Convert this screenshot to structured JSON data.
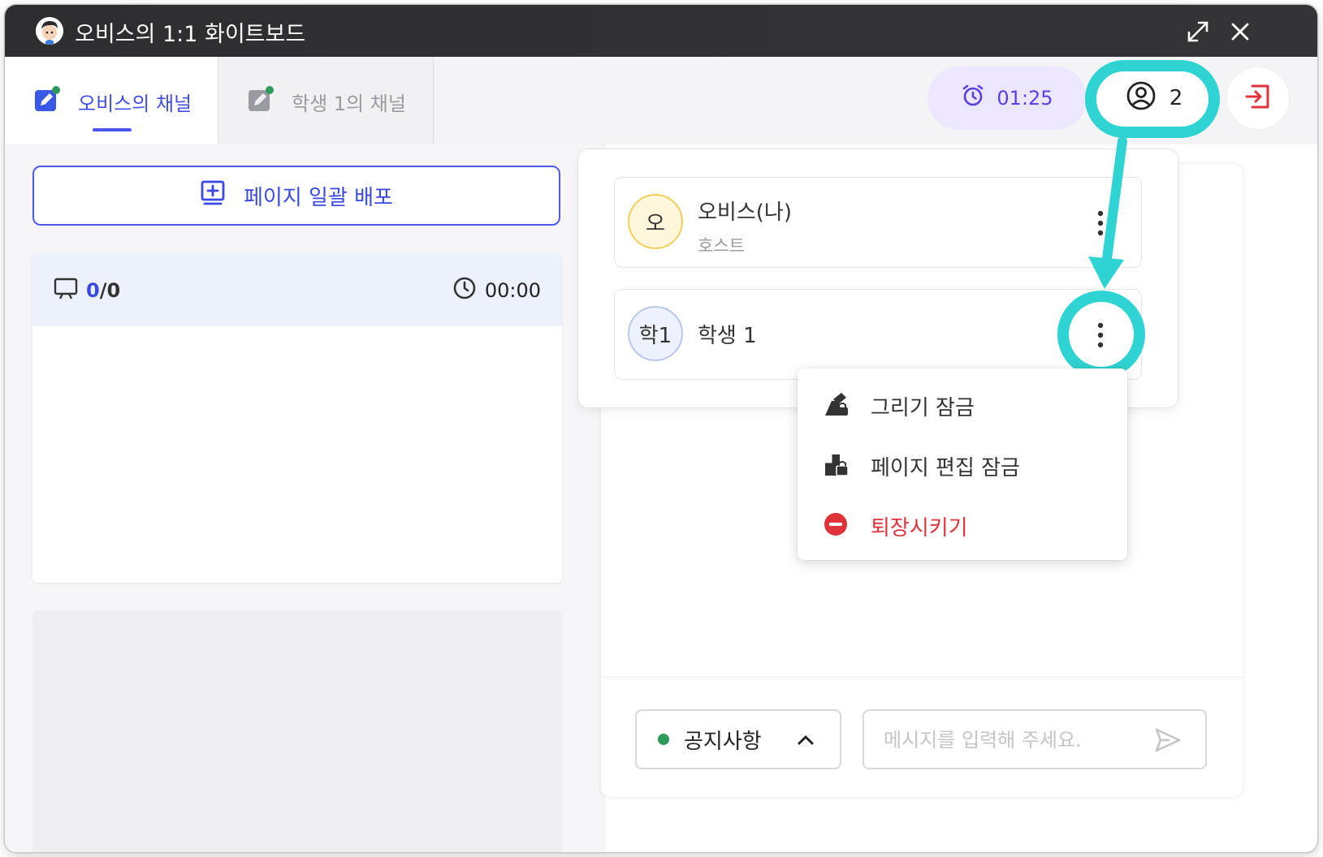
{
  "window": {
    "title": "오비스의 1:1 화이트보드"
  },
  "tabs": [
    {
      "label": "오비스의 채널",
      "active": true
    },
    {
      "label": "학생 1의 채널",
      "active": false
    }
  ],
  "header": {
    "timer": "01:25",
    "participant_count": "2"
  },
  "left_panel": {
    "distribute_button": "페이지 일괄 배포",
    "page_card": {
      "current": "0",
      "separator": "/",
      "total": "0",
      "time": "00:00"
    }
  },
  "participants": [
    {
      "avatar": "오",
      "name": "오비스(나)",
      "role": "호스트",
      "avatar_color": "#fff6dc",
      "avatar_border": "#f2cf5b"
    },
    {
      "avatar": "학1",
      "name": "학생 1",
      "role": "",
      "avatar_color": "#eef2fe",
      "avatar_border": "#b9c6ee"
    }
  ],
  "menu": {
    "items": [
      {
        "label": "그리기 잠금",
        "icon": "draw-lock-icon"
      },
      {
        "label": "페이지 편집 잠금",
        "icon": "page-edit-lock-icon"
      },
      {
        "label": "퇴장시키기",
        "icon": "kick-out-icon",
        "danger": true
      }
    ]
  },
  "chat": {
    "notice_label": "공지사항",
    "message_placeholder": "메시지를 입력해 주세요."
  },
  "colors": {
    "accent": "#3f4ee8",
    "highlight": "#2fd3d1",
    "danger": "#e0323a",
    "timer_bg": "#ece6ff"
  }
}
